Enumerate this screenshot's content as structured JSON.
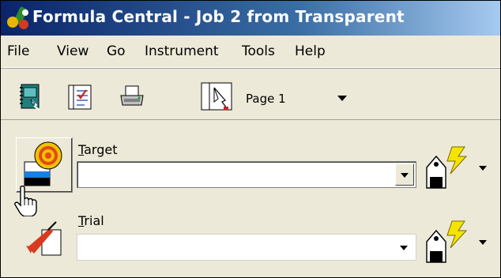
{
  "window": {
    "title": "Formula Central  -  Job 2 from Transparent"
  },
  "menu": {
    "items": [
      "File",
      "View",
      "Go",
      "Instrument",
      "Tools",
      "Help"
    ]
  },
  "toolbar": {
    "buttons": [
      "notebook-icon",
      "checklist-icon",
      "printer-icon"
    ],
    "page_selector": {
      "label": "Page 1"
    }
  },
  "fields": {
    "target": {
      "label": "Target",
      "value": ""
    },
    "trial": {
      "label": "Trial",
      "value": ""
    }
  },
  "colors": {
    "titlebar_start": "#0a246a",
    "titlebar_end": "#a6caf0",
    "chrome": "#ece9d8"
  }
}
